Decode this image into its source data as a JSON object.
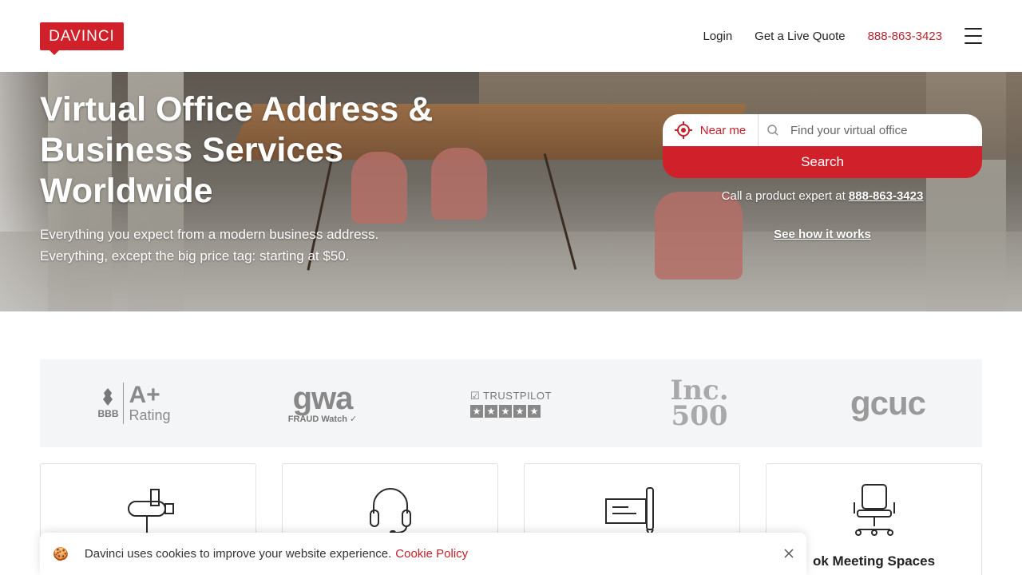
{
  "header": {
    "logo": "DAVINCI",
    "nav": {
      "login": "Login",
      "quote": "Get a Live Quote",
      "phone": "888-863-3423"
    }
  },
  "hero": {
    "title": "Virtual Office Address & Business Services Worldwide",
    "subtitle_line1": "Everything you expect from a modern business address.",
    "subtitle_line2": "Everything, except the big price tag: starting at $50.",
    "near_me": "Near me",
    "search_placeholder": "Find your virtual office",
    "search_button": "Search",
    "call_text": "Call a product expert at",
    "call_phone": "888-863-3423",
    "how_link": "See how it works"
  },
  "trust_badges": {
    "bbb_mark": "BBB",
    "bbb_grade": "A+",
    "bbb_rating": "Rating",
    "gwa_name": "gwa",
    "gwa_sub": "FRAUD Watch",
    "trustpilot": "TRUSTPILOT",
    "inc_top": "Inc.",
    "inc_bottom": "500",
    "gcuc": "gcuc"
  },
  "cards": [
    {
      "icon": "mailbox-icon",
      "title": ""
    },
    {
      "icon": "headset-icon",
      "title": ""
    },
    {
      "icon": "check-pen-icon",
      "title": ""
    },
    {
      "icon": "office-chair-icon",
      "title": "ok Meeting Spaces"
    }
  ],
  "cookie": {
    "message": "Davinci uses cookies to improve your website experience.",
    "policy_link": "Cookie Policy"
  },
  "colors": {
    "brand_red": "#d0202a",
    "phone_red": "#b3262d",
    "trust_bg": "#f4f5f7"
  }
}
